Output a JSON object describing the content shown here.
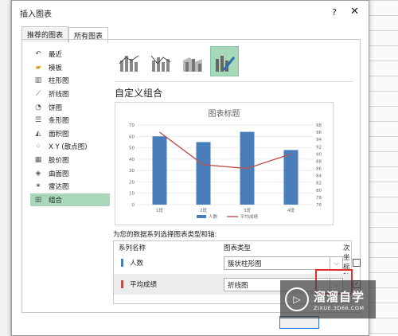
{
  "dialog": {
    "title": "插入图表",
    "help": "?",
    "close": "✕"
  },
  "tabs": [
    {
      "label": "推荐的图表"
    },
    {
      "label": "所有图表"
    }
  ],
  "categories": [
    {
      "label": "最近",
      "icon": "↶"
    },
    {
      "label": "模板",
      "icon": "▰"
    },
    {
      "label": "柱形图",
      "icon": "▥"
    },
    {
      "label": "折线图",
      "icon": "⟋"
    },
    {
      "label": "饼图",
      "icon": "◔"
    },
    {
      "label": "条形图",
      "icon": "☰"
    },
    {
      "label": "面积图",
      "icon": "◭"
    },
    {
      "label": "X Y (散点图)",
      "icon": "⁘"
    },
    {
      "label": "股价图",
      "icon": "▦"
    },
    {
      "label": "曲面图",
      "icon": "◈"
    },
    {
      "label": "雷达图",
      "icon": "✶"
    },
    {
      "label": "组合",
      "icon": "▥"
    }
  ],
  "section_heading": "自定义组合",
  "chart_data": {
    "type": "bar",
    "title": "图表标题",
    "categories": [
      "1班",
      "2班",
      "3班",
      "4班"
    ],
    "series": [
      {
        "name": "人数",
        "type": "bar",
        "axis": "primary",
        "values": [
          60,
          55,
          64,
          48
        ],
        "color": "#4a7ebb"
      },
      {
        "name": "平均成绩",
        "type": "line",
        "axis": "secondary",
        "values": [
          96,
          87,
          86,
          90
        ],
        "color": "#c0504d"
      }
    ],
    "y_left": {
      "min": 0,
      "max": 70,
      "step": 10
    },
    "y_right": {
      "min": 76,
      "max": 98,
      "step": 2
    },
    "legend": "bottom"
  },
  "series_section": {
    "label": "为您的数据系列选择图表类型和轴:",
    "headers": {
      "name": "系列名称",
      "type": "图表类型",
      "axis": "次坐标轴"
    },
    "rows": [
      {
        "name": "人数",
        "type": "簇状柱形图",
        "secondary": false,
        "color": "#4a7ebb"
      },
      {
        "name": "平均成绩",
        "type": "折线图",
        "secondary": true,
        "color": "#c0504d"
      }
    ]
  },
  "watermark": {
    "brand": "溜溜自学",
    "domain": "ZIXUE.3D66.COM",
    "icon": "▷"
  }
}
